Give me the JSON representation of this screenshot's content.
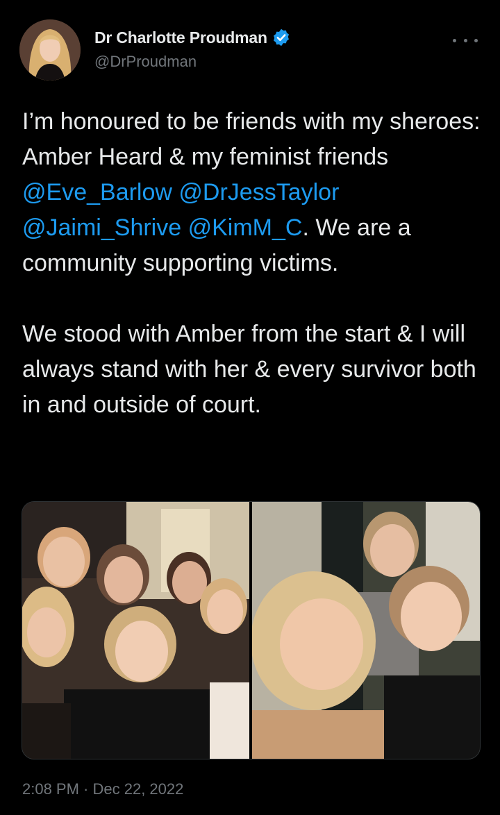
{
  "author": {
    "display_name": "Dr Charlotte Proudman",
    "handle": "@DrProudman",
    "verified": true,
    "avatar_icon": "profile-photo"
  },
  "tweet": {
    "p1_a": "I’m honoured to be friends with my sheroes: Amber Heard & my feminist friends ",
    "m1": "@Eve_Barlow",
    "s1": " ",
    "m2": "@DrJessTaylor",
    "s2": " ",
    "m3": "@Jaimi_Shrive",
    "s3": " ",
    "m4": "@KimM_C",
    "p1_b": ". We are a community supporting victims.",
    "p2": "We stood with Amber from the start & I will always stand with her & every survivor both in and outside of court."
  },
  "media": {
    "left_photo": "group-selfie-photo",
    "right_photo": "selfie-photo"
  },
  "meta": {
    "timestamp": "2:08 PM · Dec 22, 2022"
  },
  "colors": {
    "background": "#000000",
    "text": "#e7e9ea",
    "secondary": "#71767b",
    "link": "#1d9bf0",
    "verified": "#1d9bf0"
  }
}
